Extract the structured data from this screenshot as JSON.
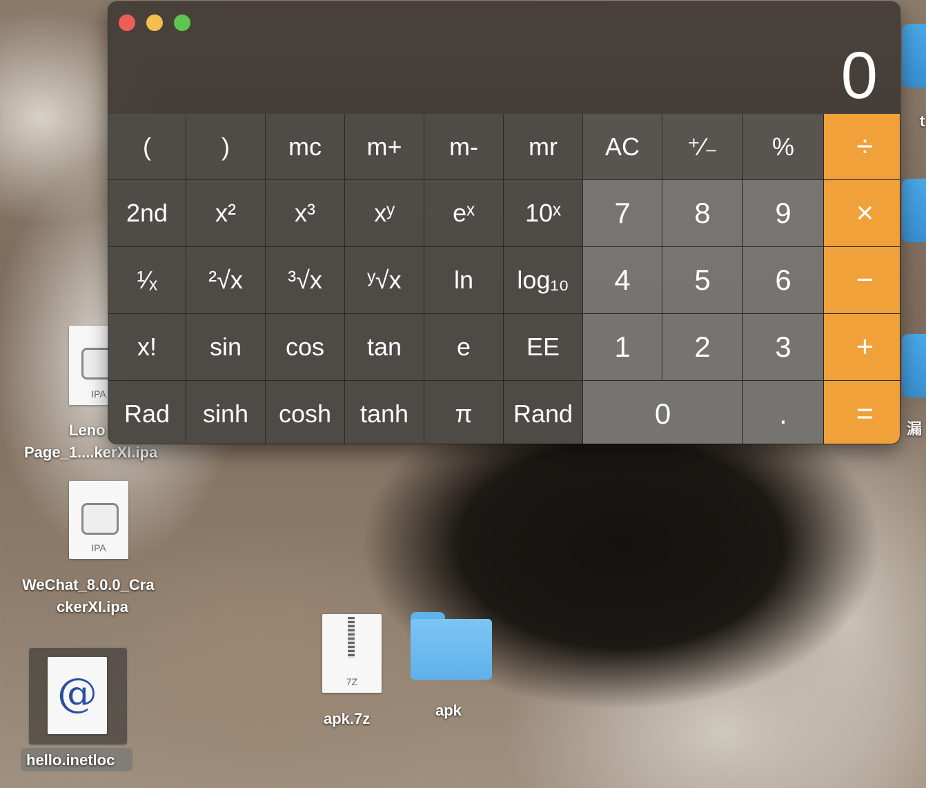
{
  "calculator": {
    "display_value": "0",
    "colors": {
      "operator": "#f0a13a",
      "close": "#ed5f56",
      "minimize": "#f4bd4f",
      "zoom": "#5ec551"
    },
    "keys": [
      "(",
      ")",
      "mc",
      "m+",
      "m-",
      "mr",
      "AC",
      "⁺∕₋",
      "%",
      "÷",
      "2nd",
      "x²",
      "x³",
      "xʸ",
      "eˣ",
      "10ˣ",
      "7",
      "8",
      "9",
      "×",
      "¹⁄ₓ",
      "²√x",
      "³√x",
      "ʸ√x",
      "ln",
      "log₁₀",
      "4",
      "5",
      "6",
      "−",
      "x!",
      "sin",
      "cos",
      "tan",
      "e",
      "EE",
      "1",
      "2",
      "3",
      "+",
      "Rad",
      "sinh",
      "cosh",
      "tanh",
      "π",
      "Rand",
      "0",
      ".",
      "="
    ]
  },
  "desktop": {
    "items": [
      {
        "name": "Page_1....kerXI.ipa",
        "name_line1": "Leno",
        "type_tag": "IPA",
        "icon": "ipa-file-icon"
      },
      {
        "name_line1": "WeChat_8.0.0_Cra",
        "name_line2": "ckerXI.ipa",
        "type_tag": "IPA",
        "icon": "ipa-file-icon"
      },
      {
        "name": "hello.inetloc",
        "icon": "inetloc-file-icon"
      },
      {
        "name": "apk.7z",
        "type_tag": "7Z",
        "icon": "archive-file-icon"
      },
      {
        "name": "apk",
        "icon": "folder-icon"
      }
    ],
    "right_edge_fragments": [
      "t",
      "漏"
    ]
  }
}
